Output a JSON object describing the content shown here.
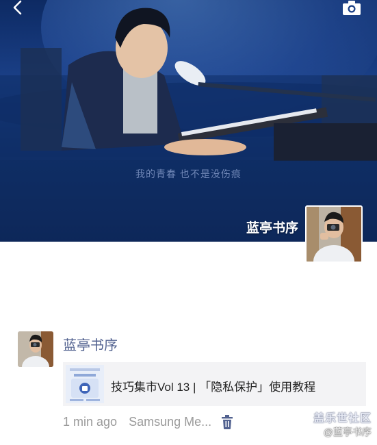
{
  "cover": {
    "subtitle": "我的青春  也不是没伤痕"
  },
  "owner": {
    "name": "蓝亭书序"
  },
  "post": {
    "author": "蓝亭书序",
    "link_title": "技巧集市Vol 13 | 「隐私保护」使用教程",
    "time": "1 min ago",
    "source": "Samsung Me..."
  },
  "watermark": {
    "logo": "盖乐世社区",
    "handle": "@蓝亭书序"
  },
  "icons": {
    "back": "chevron-left-icon",
    "camera": "camera-icon",
    "trash": "trash-icon"
  },
  "colors": {
    "accent": "#51618f",
    "cover_bg": "#1a3f86"
  }
}
